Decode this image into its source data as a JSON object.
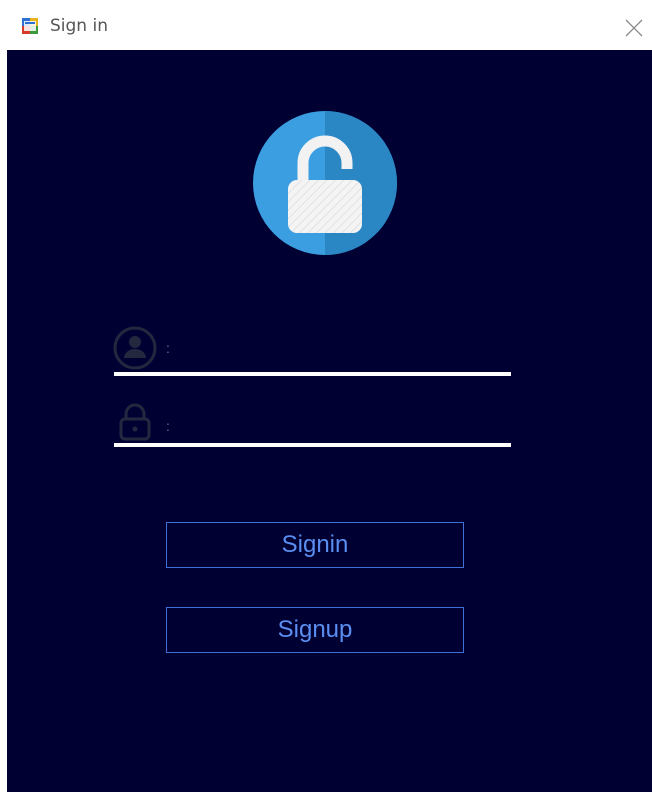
{
  "window": {
    "title": "Sign in"
  },
  "login": {
    "username_separator": ":",
    "username_value": "",
    "password_separator": ":",
    "password_value": ""
  },
  "buttons": {
    "signin_label": "Signin",
    "signup_label": "Signup"
  },
  "icons": {
    "app": "app-window-icon",
    "close": "close-icon",
    "logo": "unlocked-padlock-icon",
    "user": "user-icon",
    "password": "lock-icon"
  },
  "colors": {
    "background": "#000033",
    "logo_circle": "#3a9ee0",
    "button_accent": "#5a8ef0",
    "underline": "#ffffff"
  }
}
